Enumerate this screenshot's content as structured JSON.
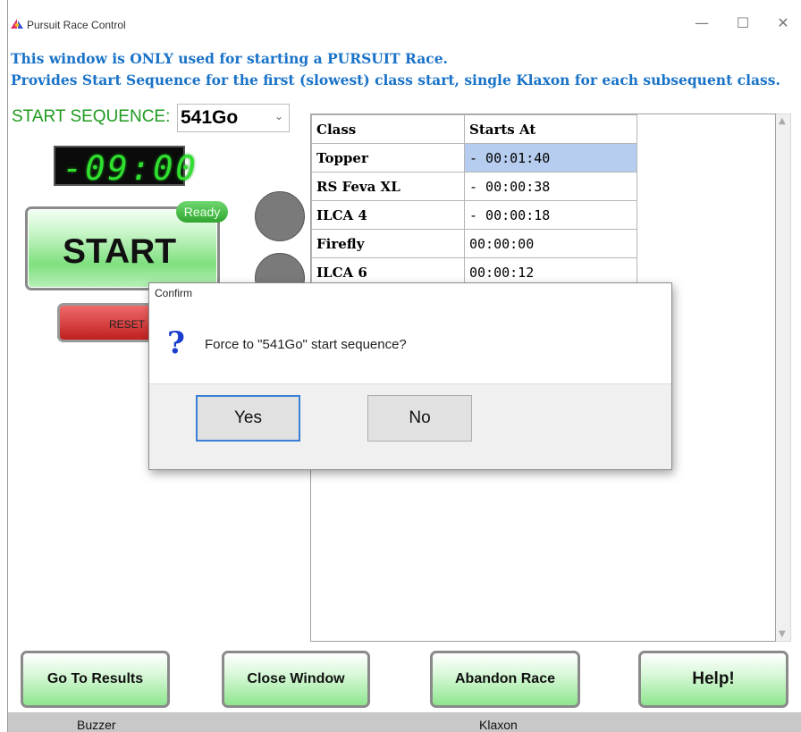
{
  "window": {
    "title": "Pursuit Race Control",
    "minimize": "—",
    "maximize": "☐",
    "close": "✕"
  },
  "info": {
    "line1": "This window is ONLY used for starting a PURSUIT Race.",
    "line2": "Provides  Start Sequence for the first (slowest) class start, single Klaxon for each subsequent class."
  },
  "sequence": {
    "label": "START SEQUENCE:",
    "value": "541Go"
  },
  "clock": {
    "display": "-09:00"
  },
  "start": {
    "label": "START",
    "badge": "Ready"
  },
  "reset": {
    "label": "RESET"
  },
  "table": {
    "headers": [
      "Class",
      "Starts At"
    ],
    "rows": [
      {
        "class": "Topper",
        "starts": "- 00:01:40"
      },
      {
        "class": "RS Feva XL",
        "starts": "- 00:00:38"
      },
      {
        "class": "ILCA 4",
        "starts": "- 00:00:18"
      },
      {
        "class": "Firefly",
        "starts": "00:00:00"
      },
      {
        "class": "ILCA 6",
        "starts": "00:00:12"
      }
    ]
  },
  "dialog": {
    "title": "Confirm",
    "message": "Force to \"541Go\" start sequence?",
    "yes": "Yes",
    "no": "No"
  },
  "buttons": {
    "results": "Go To Results",
    "close": "Close Window",
    "abandon": "Abandon Race",
    "help": "Help!"
  },
  "status": {
    "buzzer": "Buzzer",
    "klaxon": "Klaxon"
  },
  "colors": {
    "info_text": "#1a73c8",
    "sequence_label": "#1f9b1f",
    "clock_digits": "#2fe02f",
    "selected_cell": "#b6cdef"
  }
}
